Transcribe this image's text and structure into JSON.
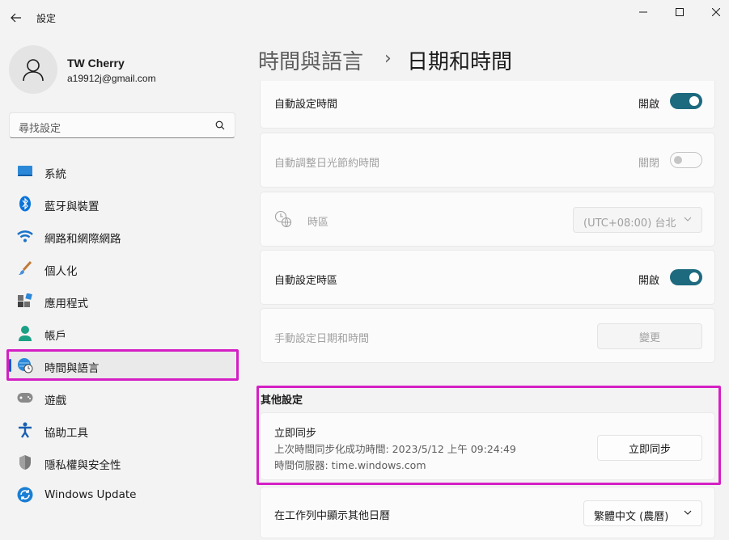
{
  "app": {
    "title": "設定"
  },
  "user": {
    "name": "TW Cherry",
    "email": "a19912j@gmail.com"
  },
  "search": {
    "placeholder": "尋找設定"
  },
  "sidebar": {
    "items": [
      {
        "label": "系統",
        "icon": "monitor-icon"
      },
      {
        "label": "藍牙與裝置",
        "icon": "bluetooth-icon"
      },
      {
        "label": "網路和網際網路",
        "icon": "wifi-icon"
      },
      {
        "label": "個人化",
        "icon": "brush-icon"
      },
      {
        "label": "應用程式",
        "icon": "apps-icon"
      },
      {
        "label": "帳戶",
        "icon": "person-icon"
      },
      {
        "label": "時間與語言",
        "icon": "globe-clock-icon",
        "active": true
      },
      {
        "label": "遊戲",
        "icon": "gamepad-icon"
      },
      {
        "label": "協助工具",
        "icon": "accessibility-icon"
      },
      {
        "label": "隱私權與安全性",
        "icon": "shield-icon"
      },
      {
        "label": "Windows Update",
        "icon": "update-icon"
      }
    ]
  },
  "header": {
    "parent": "時間與語言",
    "separator": "›",
    "current": "日期和時間"
  },
  "settings": {
    "auto_time": {
      "label": "自動設定時間",
      "state": "開啟",
      "on": true
    },
    "dst": {
      "label": "自動調整日光節約時間",
      "state": "關閉",
      "on": false
    },
    "timezone": {
      "label": "時區",
      "value": "(UTC+08:00) 台北"
    },
    "auto_timezone": {
      "label": "自動設定時區",
      "state": "開啟",
      "on": true
    },
    "manual": {
      "label": "手動設定日期和時間",
      "button": "變更"
    }
  },
  "other": {
    "title": "其他設定",
    "sync": {
      "title": "立即同步",
      "last_sync": "上次時間同步化成功時間: 2023/5/12 上午 09:24:49",
      "server": "時間伺服器: time.windows.com",
      "button": "立即同步"
    },
    "calendar": {
      "label": "在工作列中顯示其他日曆",
      "value": "繁體中文 (農曆)"
    }
  },
  "colors": {
    "accent": "#1d6a7f",
    "highlight": "#d41fc4",
    "nav_active": "#005fb8"
  }
}
